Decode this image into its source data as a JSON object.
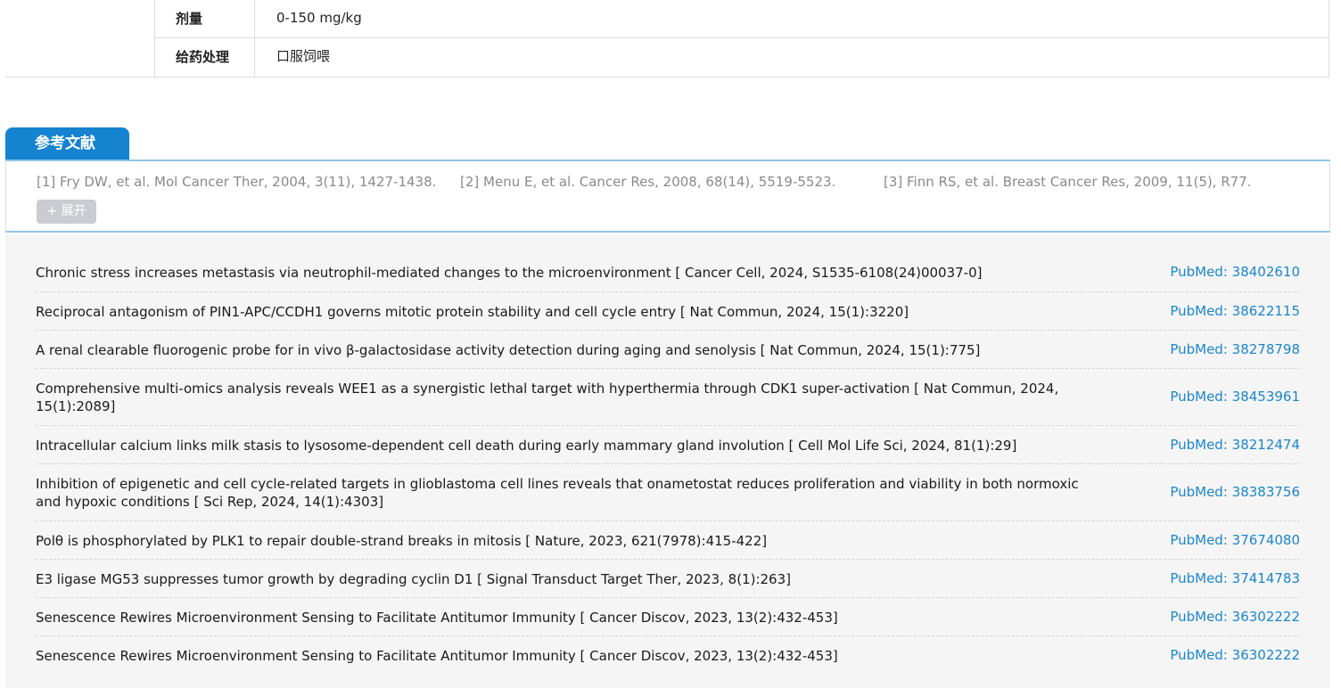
{
  "dosing": {
    "rows": [
      {
        "key": "剂量",
        "value": "0-150 mg/kg"
      },
      {
        "key": "给药处理",
        "value": "口服饲喂"
      }
    ]
  },
  "references": {
    "tab_label": "参考文献",
    "items": [
      "[1] Fry DW, et al. Mol Cancer Ther, 2004, 3(11), 1427-1438.",
      "[2] Menu E, et al. Cancer Res, 2008, 68(14), 5519-5523.",
      "[3] Finn RS, et al. Breast Cancer Res, 2009, 11(5), R77."
    ],
    "expand_label": "+ 展开"
  },
  "citations": [
    {
      "title": "Chronic stress increases metastasis via neutrophil-mediated changes to the microenvironment [ Cancer Cell, 2024, S1535-6108(24)00037-0]",
      "pubmed": "PubMed: 38402610"
    },
    {
      "title": "Reciprocal antagonism of PIN1-APC/CCDH1 governs mitotic protein stability and cell cycle entry [ Nat Commun, 2024, 15(1):3220]",
      "pubmed": "PubMed: 38622115"
    },
    {
      "title": "A renal clearable fluorogenic probe for in vivo β-galactosidase activity detection during aging and senolysis [ Nat Commun, 2024, 15(1):775]",
      "pubmed": "PubMed: 38278798"
    },
    {
      "title": "Comprehensive multi-omics analysis reveals WEE1 as a synergistic lethal target with hyperthermia through CDK1 super-activation [ Nat Commun, 2024, 15(1):2089]",
      "pubmed": "PubMed: 38453961"
    },
    {
      "title": "Intracellular calcium links milk stasis to lysosome-dependent cell death during early mammary gland involution [ Cell Mol Life Sci, 2024, 81(1):29]",
      "pubmed": "PubMed: 38212474"
    },
    {
      "title": "Inhibition of epigenetic and cell cycle-related targets in glioblastoma cell lines reveals that onametostat reduces proliferation and viability in both normoxic and hypoxic conditions [ Sci Rep, 2024, 14(1):4303]",
      "pubmed": "PubMed: 38383756"
    },
    {
      "title": "Polθ is phosphorylated by PLK1 to repair double-strand breaks in mitosis [ Nature, 2023, 621(7978):415-422]",
      "pubmed": "PubMed: 37674080"
    },
    {
      "title": "E3 ligase MG53 suppresses tumor growth by degrading cyclin D1 [ Signal Transduct Target Ther, 2023, 8(1):263]",
      "pubmed": "PubMed: 37414783"
    },
    {
      "title": "Senescence Rewires Microenvironment Sensing to Facilitate Antitumor Immunity [ Cancer Discov, 2023, 13(2):432-453]",
      "pubmed": "PubMed: 36302222"
    },
    {
      "title": "Senescence Rewires Microenvironment Sensing to Facilitate Antitumor Immunity [ Cancer Discov, 2023, 13(2):432-453]",
      "pubmed": "PubMed: 36302222"
    }
  ]
}
